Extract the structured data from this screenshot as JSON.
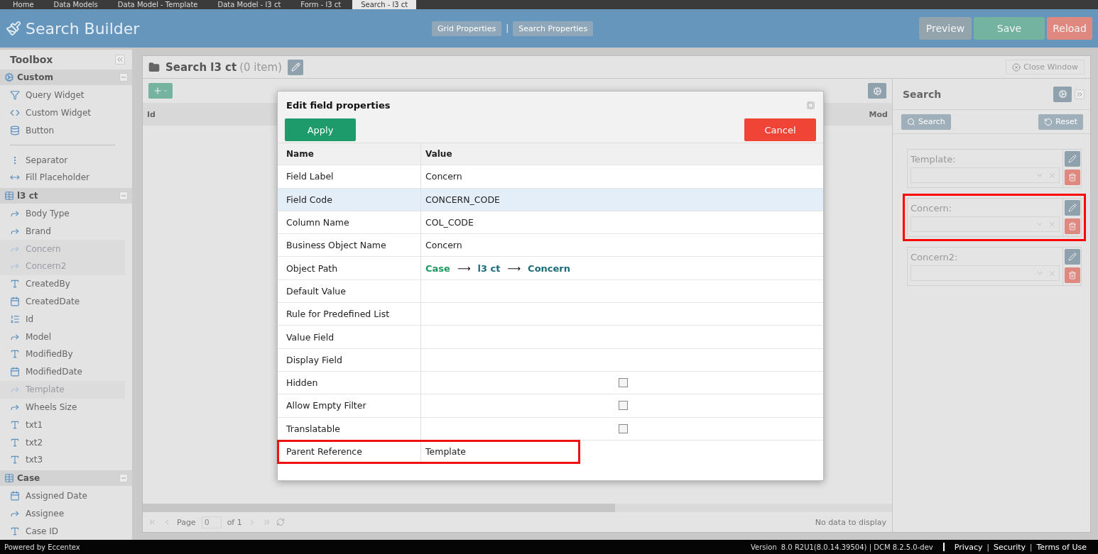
{
  "doc_tabs": [
    {
      "label": "Home",
      "selected": false
    },
    {
      "label": "Data Models",
      "selected": false
    },
    {
      "label": "Data Model - Template",
      "selected": false
    },
    {
      "label": "Data Model - l3 ct",
      "selected": false
    },
    {
      "label": "Form - l3 ct",
      "selected": false
    },
    {
      "label": "Search - l3 ct",
      "selected": true
    }
  ],
  "header": {
    "title": "Search Builder",
    "center_buttons": [
      "Grid Properties",
      "Search Properties"
    ],
    "separator": "|",
    "buttons": [
      {
        "label": "Preview",
        "kind": "preview"
      },
      {
        "label": "Save",
        "kind": "save"
      },
      {
        "label": "Reload",
        "kind": "reload"
      }
    ]
  },
  "toolbox": {
    "title": "Toolbox",
    "sections": [
      {
        "title": "Custom",
        "items": [
          {
            "label": "Query Widget",
            "kind": "widget",
            "disabled": false
          },
          {
            "label": "Custom Widget",
            "kind": "widget",
            "disabled": false
          },
          {
            "label": "Button",
            "kind": "widget",
            "disabled": false
          },
          {
            "kind": "divider"
          },
          {
            "label": "Separator",
            "kind": "widget",
            "disabled": false
          },
          {
            "label": "Fill Placeholder",
            "kind": "widget",
            "disabled": false
          }
        ]
      },
      {
        "title": "l3 ct",
        "items": [
          {
            "label": "Body Type",
            "kind": "reference",
            "disabled": false
          },
          {
            "label": "Brand",
            "kind": "reference",
            "disabled": false
          },
          {
            "label": "Concern",
            "kind": "reference",
            "disabled": true
          },
          {
            "label": "Concern2",
            "kind": "reference",
            "disabled": true
          },
          {
            "label": "CreatedBy",
            "kind": "text",
            "disabled": false
          },
          {
            "label": "CreatedDate",
            "kind": "date",
            "disabled": false
          },
          {
            "label": "Id",
            "kind": "number",
            "disabled": false
          },
          {
            "label": "Model",
            "kind": "reference",
            "disabled": false
          },
          {
            "label": "ModifiedBy",
            "kind": "text",
            "disabled": false
          },
          {
            "label": "ModifiedDate",
            "kind": "date",
            "disabled": false
          },
          {
            "label": "Template",
            "kind": "reference",
            "disabled": true
          },
          {
            "label": "Wheels Size",
            "kind": "reference",
            "disabled": false
          },
          {
            "label": "txt1",
            "kind": "text",
            "disabled": false
          },
          {
            "label": "txt2",
            "kind": "text",
            "disabled": false
          },
          {
            "label": "txt3",
            "kind": "text",
            "disabled": false
          }
        ]
      },
      {
        "title": "Case",
        "items": [
          {
            "label": "Assigned Date",
            "kind": "date",
            "disabled": false
          },
          {
            "label": "Assignee",
            "kind": "reference",
            "disabled": false
          },
          {
            "label": "Case ID",
            "kind": "text",
            "disabled": false
          }
        ]
      }
    ]
  },
  "grid": {
    "title": "Search l3 ct",
    "count": "(0 item)",
    "close": "Close Window",
    "columns": [
      "Id",
      "Mod"
    ],
    "pager": {
      "page_label": "Page",
      "page": "0",
      "of": "of 1",
      "empty": "No data to display"
    }
  },
  "search_panel": {
    "title": "Search",
    "search": "Search",
    "reset": "Reset",
    "fields": [
      {
        "label": "Template:",
        "highlighted": false
      },
      {
        "label": "Concern:",
        "highlighted": true
      },
      {
        "label": "Concern2:",
        "highlighted": false
      }
    ]
  },
  "dialog": {
    "title": "Edit field properties",
    "apply": "Apply",
    "cancel": "Cancel",
    "columns": [
      "Name",
      "Value"
    ],
    "rows": [
      {
        "name": "Field Label",
        "kind": "text",
        "value": "Concern",
        "selected": false,
        "highlighted": false
      },
      {
        "name": "Field Code",
        "kind": "text",
        "value": "CONCERN_CODE",
        "selected": true,
        "highlighted": false
      },
      {
        "name": "Column Name",
        "kind": "text",
        "value": "COL_CODE",
        "selected": false,
        "highlighted": false
      },
      {
        "name": "Business Object Name",
        "kind": "text",
        "value": "Concern",
        "selected": false,
        "highlighted": false
      },
      {
        "name": "Object Path",
        "kind": "path",
        "path": [
          "Case",
          "l3 ct",
          "Concern"
        ],
        "arrow": "⟶",
        "selected": false,
        "highlighted": false
      },
      {
        "name": "Default Value",
        "kind": "text",
        "selected": false,
        "highlighted": false
      },
      {
        "name": "Rule for Predefined List",
        "kind": "text",
        "selected": false,
        "highlighted": false
      },
      {
        "name": "Value Field",
        "kind": "text",
        "selected": false,
        "highlighted": false
      },
      {
        "name": "Display Field",
        "kind": "text",
        "selected": false,
        "highlighted": false
      },
      {
        "name": "Hidden",
        "kind": "checkbox",
        "checked": false,
        "selected": false,
        "highlighted": false
      },
      {
        "name": "Allow Empty Filter",
        "kind": "checkbox",
        "checked": false,
        "selected": false,
        "highlighted": false
      },
      {
        "name": "Translatable",
        "kind": "checkbox",
        "checked": false,
        "selected": false,
        "highlighted": false
      },
      {
        "name": "Parent Reference",
        "kind": "text",
        "value": "Template",
        "selected": false,
        "highlighted": true
      }
    ]
  },
  "footer": {
    "powered": "Powered by Eccentex",
    "version_label": "Version",
    "version": "8.0 R2U1(8.0.14.39504) | DCM 8.2.5.0-dev",
    "links": [
      "Privacy",
      "Security",
      "Terms of Use"
    ],
    "sep": "|"
  }
}
